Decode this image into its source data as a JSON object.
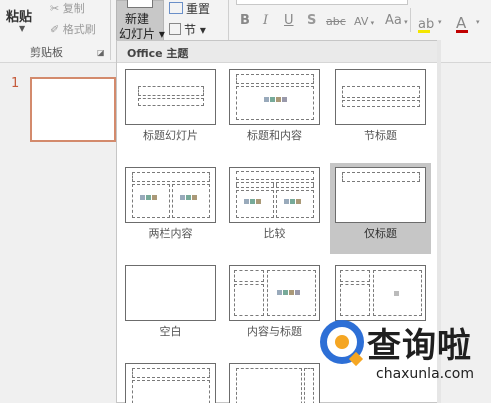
{
  "ribbon": {
    "clipboard": {
      "paste_label": "粘贴",
      "cut_label": "✂ 复制",
      "format_painter_label": "✐ 格式刷",
      "group_label": "剪贴板"
    },
    "slides": {
      "new_slide_line1": "新建",
      "new_slide_line2": "幻灯片 ▾",
      "reset_label": "重置",
      "section_label": "节 ▾"
    },
    "font": {
      "bold": "B",
      "italic": "I",
      "underline": "U",
      "shadow": "S",
      "strikethrough": "abc",
      "spacing": "AV",
      "case": "Aa",
      "highlight": "ab",
      "font_color": "A",
      "highlight_color": "#f3e600",
      "font_color_value": "#c00000"
    }
  },
  "slide_panel": {
    "slide_number": "1"
  },
  "gallery": {
    "header": "Office 主题",
    "layouts": [
      {
        "label": "标题幻灯片",
        "selected": false
      },
      {
        "label": "标题和内容",
        "selected": false
      },
      {
        "label": "节标题",
        "selected": false
      },
      {
        "label": "两栏内容",
        "selected": false
      },
      {
        "label": "比较",
        "selected": false
      },
      {
        "label": "仅标题",
        "selected": true
      },
      {
        "label": "空白",
        "selected": false
      },
      {
        "label": "内容与标题",
        "selected": false
      },
      {
        "label": "",
        "selected": false
      },
      {
        "label": "",
        "selected": false
      },
      {
        "label": "",
        "selected": false
      }
    ]
  },
  "watermark": {
    "brand": "查询啦",
    "url": "chaxunla.com",
    "blue": "#2d6fd6",
    "orange": "#f5a623"
  }
}
